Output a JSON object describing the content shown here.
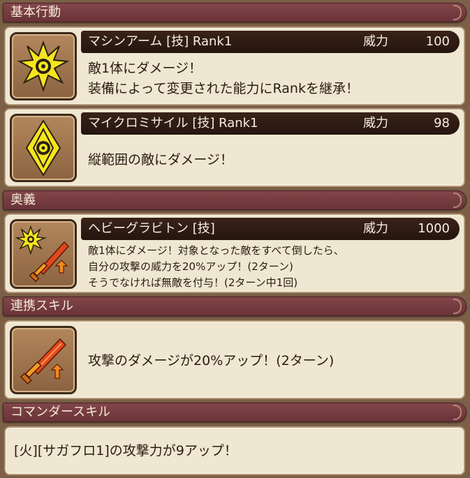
{
  "sections": {
    "basic": "基本行動",
    "ougi": "奥義",
    "renkei": "連携スキル",
    "commander": "コマンダースキル"
  },
  "skills": [
    {
      "name": "マシンアーム [技]  Rank1",
      "power_label": "威力",
      "power": "100",
      "icon": "yellow-starburst-icon",
      "desc": [
        "敵1体にダメージ！",
        "装備によって変更された能力にRankを継承！"
      ]
    },
    {
      "name": "マイクロミサイル [技]  Rank1",
      "power_label": "威力",
      "power": "98",
      "icon": "yellow-diamond-eye-icon",
      "desc": [
        "縦範囲の敵にダメージ！"
      ]
    },
    {
      "name": "ヘビーグラビトン [技]",
      "power_label": "威力",
      "power": "1000",
      "icon": "starburst-and-sword-icon",
      "desc": [
        "敵1体にダメージ！対象となった敵をすべて倒したら、",
        "自分の攻撃の威力を20%アップ！(2ターン)",
        "そうでなければ無敵を付与！(2ターン中1回)"
      ]
    }
  ],
  "renkei": {
    "icon": "flame-sword-up-icon",
    "desc": "攻撃のダメージが20%アップ！(2ターン)"
  },
  "commander": {
    "desc": "[火][サガフロ1]の攻撃力が9アップ！"
  },
  "colors": {
    "background": "#7b5f47",
    "header": "#743c41",
    "card": "#efe7d1",
    "title_bar": "#2e1c14",
    "icon_yellow": "#f4e51e",
    "sword_red": "#e2461e"
  }
}
